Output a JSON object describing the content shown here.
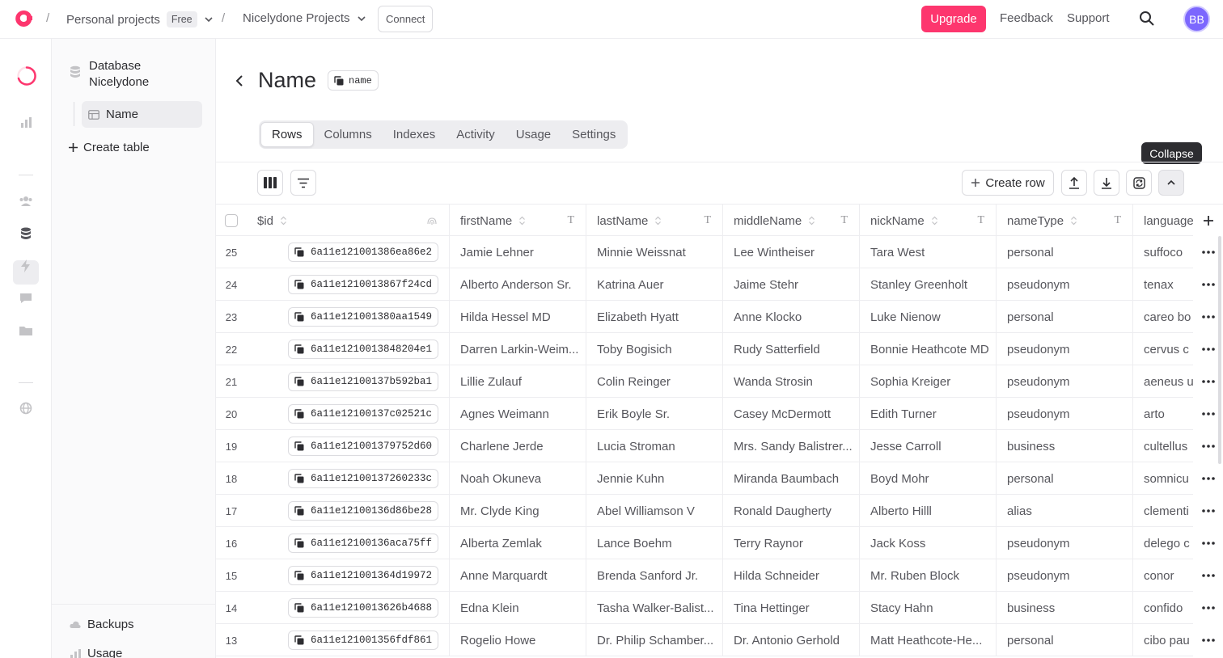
{
  "topbar": {
    "org": "Personal projects",
    "plan_badge": "Free",
    "project": "Nicelydone Projects",
    "connect_label": "Connect",
    "upgrade_label": "Upgrade",
    "feedback_label": "Feedback",
    "support_label": "Support",
    "avatar_initials": "BB"
  },
  "sidebar": {
    "database_name": "Database Nicelydone",
    "table_name": "Name",
    "create_table_label": "Create table",
    "backups_label": "Backups",
    "usage_label": "Usage"
  },
  "header": {
    "title": "Name",
    "table_id": "name"
  },
  "tabs": [
    "Rows",
    "Columns",
    "Indexes",
    "Activity",
    "Usage",
    "Settings"
  ],
  "toolbar": {
    "create_row_label": "Create row",
    "tooltip": "Collapse"
  },
  "columns": [
    "$id",
    "firstName",
    "lastName",
    "middleName",
    "nickName",
    "nameType",
    "language"
  ],
  "rows": [
    {
      "n": "25",
      "id": "6a11e121001386ea86e2",
      "firstName": "Jamie Lehner",
      "lastName": "Minnie Weissnat",
      "middleName": "Lee Wintheiser",
      "nickName": "Tara West",
      "nameType": "personal",
      "language": "suffoco"
    },
    {
      "n": "24",
      "id": "6a11e1210013867f24cd",
      "firstName": "Alberto Anderson Sr.",
      "lastName": "Katrina Auer",
      "middleName": "Jaime Stehr",
      "nickName": "Stanley Greenholt",
      "nameType": "pseudonym",
      "language": "tenax"
    },
    {
      "n": "23",
      "id": "6a11e121001380aa1549",
      "firstName": "Hilda Hessel MD",
      "lastName": "Elizabeth Hyatt",
      "middleName": "Anne Klocko",
      "nickName": "Luke Nienow",
      "nameType": "personal",
      "language": "careo bo"
    },
    {
      "n": "22",
      "id": "6a11e1210013848204e1",
      "firstName": "Darren Larkin-Weim...",
      "lastName": "Toby Bogisich",
      "middleName": "Rudy Satterfield",
      "nickName": "Bonnie Heathcote MD",
      "nameType": "pseudonym",
      "language": "cervus c"
    },
    {
      "n": "21",
      "id": "6a11e12100137b592ba1",
      "firstName": "Lillie Zulauf",
      "lastName": "Colin Reinger",
      "middleName": "Wanda Strosin",
      "nickName": "Sophia Kreiger",
      "nameType": "pseudonym",
      "language": "aeneus u"
    },
    {
      "n": "20",
      "id": "6a11e12100137c02521c",
      "firstName": "Agnes Weimann",
      "lastName": "Erik Boyle Sr.",
      "middleName": "Casey McDermott",
      "nickName": "Edith Turner",
      "nameType": "pseudonym",
      "language": "arto"
    },
    {
      "n": "19",
      "id": "6a11e121001379752d60",
      "firstName": "Charlene Jerde",
      "lastName": "Lucia Stroman",
      "middleName": "Mrs. Sandy Balistrer...",
      "nickName": "Jesse Carroll",
      "nameType": "business",
      "language": "cultellus"
    },
    {
      "n": "18",
      "id": "6a11e12100137260233c",
      "firstName": "Noah Okuneva",
      "lastName": "Jennie Kuhn",
      "middleName": "Miranda Baumbach",
      "nickName": "Boyd Mohr",
      "nameType": "personal",
      "language": "somnicu"
    },
    {
      "n": "17",
      "id": "6a11e12100136d86be28",
      "firstName": "Mr. Clyde King",
      "lastName": "Abel Williamson V",
      "middleName": "Ronald Daugherty",
      "nickName": "Alberto Hilll",
      "nameType": "alias",
      "language": "clementi"
    },
    {
      "n": "16",
      "id": "6a11e12100136aca75ff",
      "firstName": "Alberta Zemlak",
      "lastName": "Lance Boehm",
      "middleName": "Terry Raynor",
      "nickName": "Jack Koss",
      "nameType": "pseudonym",
      "language": "delego c"
    },
    {
      "n": "15",
      "id": "6a11e121001364d19972",
      "firstName": "Anne Marquardt",
      "lastName": "Brenda Sanford Jr.",
      "middleName": "Hilda Schneider",
      "nickName": "Mr. Ruben Block",
      "nameType": "pseudonym",
      "language": "conor"
    },
    {
      "n": "14",
      "id": "6a11e1210013626b4688",
      "firstName": "Edna Klein",
      "lastName": "Tasha Walker-Balist...",
      "middleName": "Tina Hettinger",
      "nickName": "Stacy Hahn",
      "nameType": "business",
      "language": "confido"
    },
    {
      "n": "13",
      "id": "6a11e121001356fdf861",
      "firstName": "Rogelio Howe",
      "lastName": "Dr. Philip Schamber...",
      "middleName": "Dr. Antonio Gerhold",
      "nickName": "Matt Heathcote-He...",
      "nameType": "personal",
      "language": "cibo pau"
    }
  ]
}
